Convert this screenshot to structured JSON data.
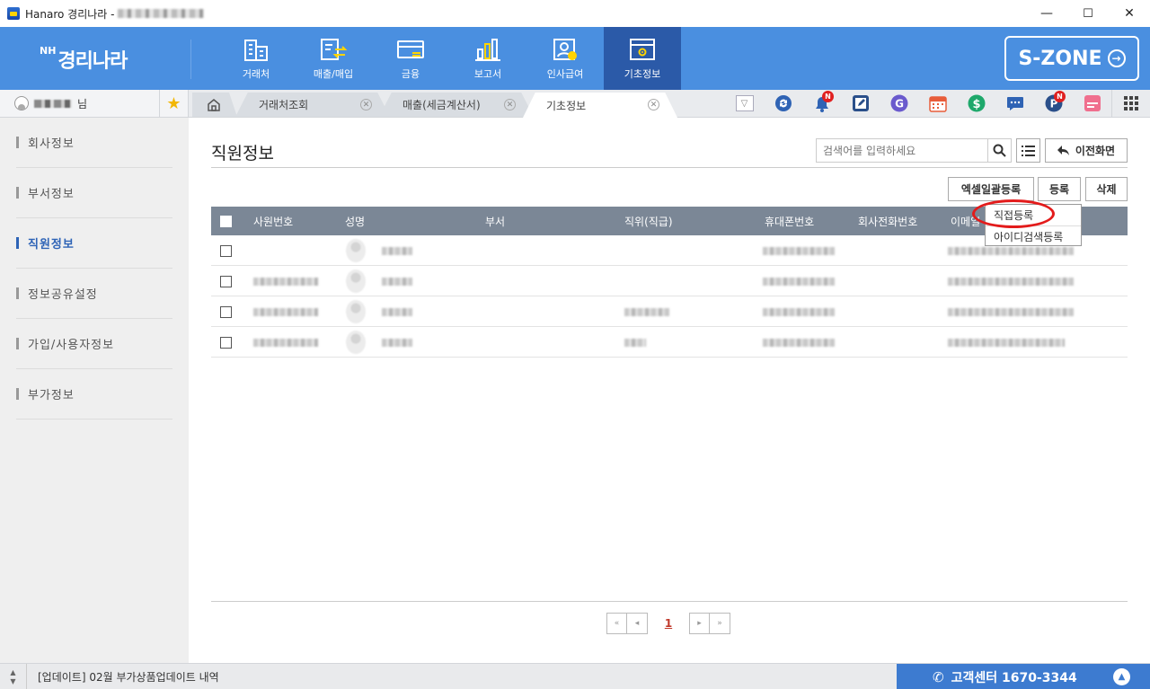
{
  "window": {
    "title": "Hanaro 경리나라 -",
    "minimize": "—",
    "maximize": "☐",
    "close": "✕"
  },
  "header": {
    "logo_prefix": "NH",
    "logo_text": "경리나라",
    "nav": [
      {
        "label": "거래처",
        "icon": "building-icon"
      },
      {
        "label": "매출/매입",
        "icon": "transfer-doc-icon"
      },
      {
        "label": "금융",
        "icon": "card-icon"
      },
      {
        "label": "보고서",
        "icon": "bar-chart-icon"
      },
      {
        "label": "인사급여",
        "icon": "person-card-icon"
      },
      {
        "label": "기초정보",
        "icon": "settings-window-icon"
      }
    ],
    "active_nav": "기초정보",
    "szone": "S-ZONE"
  },
  "tabbar": {
    "user_suffix": "님",
    "tabs": [
      {
        "label": "거래처조회"
      },
      {
        "label": "매출(세금계산서)"
      },
      {
        "label": "기초정보"
      }
    ],
    "active_tab": "기초정보",
    "tools": [
      "dropdown-icon",
      "sync-icon",
      "bell-icon",
      "edit-icon",
      "g-icon",
      "calendar-icon",
      "dollar-icon",
      "chat-icon",
      "p-icon",
      "memo-icon",
      "grid-icon"
    ],
    "badge_new": "N"
  },
  "sidebar": {
    "items": [
      "회사정보",
      "부서정보",
      "직원정보",
      "정보공유설정",
      "가입/사용자정보",
      "부가정보"
    ],
    "active": "직원정보"
  },
  "main": {
    "title": "직원정보",
    "search_placeholder": "검색어를 입력하세요",
    "prev_button": "이전화면",
    "excel_button": "엑셀일괄등록",
    "register_button": "등록",
    "delete_button": "삭제",
    "columns": [
      "사원번호",
      "성명",
      "부서",
      "직위(직급)",
      "휴대폰번호",
      "회사전화번호",
      "이메일"
    ],
    "register_menu": [
      "직접등록",
      "아이디검색등록"
    ],
    "page_current": "1"
  },
  "statusbar": {
    "notice": "[업데이트] 02월 부가상품업데이트 내역",
    "call_center": "고객센터 1670-3344"
  },
  "colors": {
    "header_blue": "#4a8fe0",
    "active_nav": "#2b5aa8",
    "accent_blue": "#2d63b6",
    "highlight_red": "#e31b1b"
  }
}
